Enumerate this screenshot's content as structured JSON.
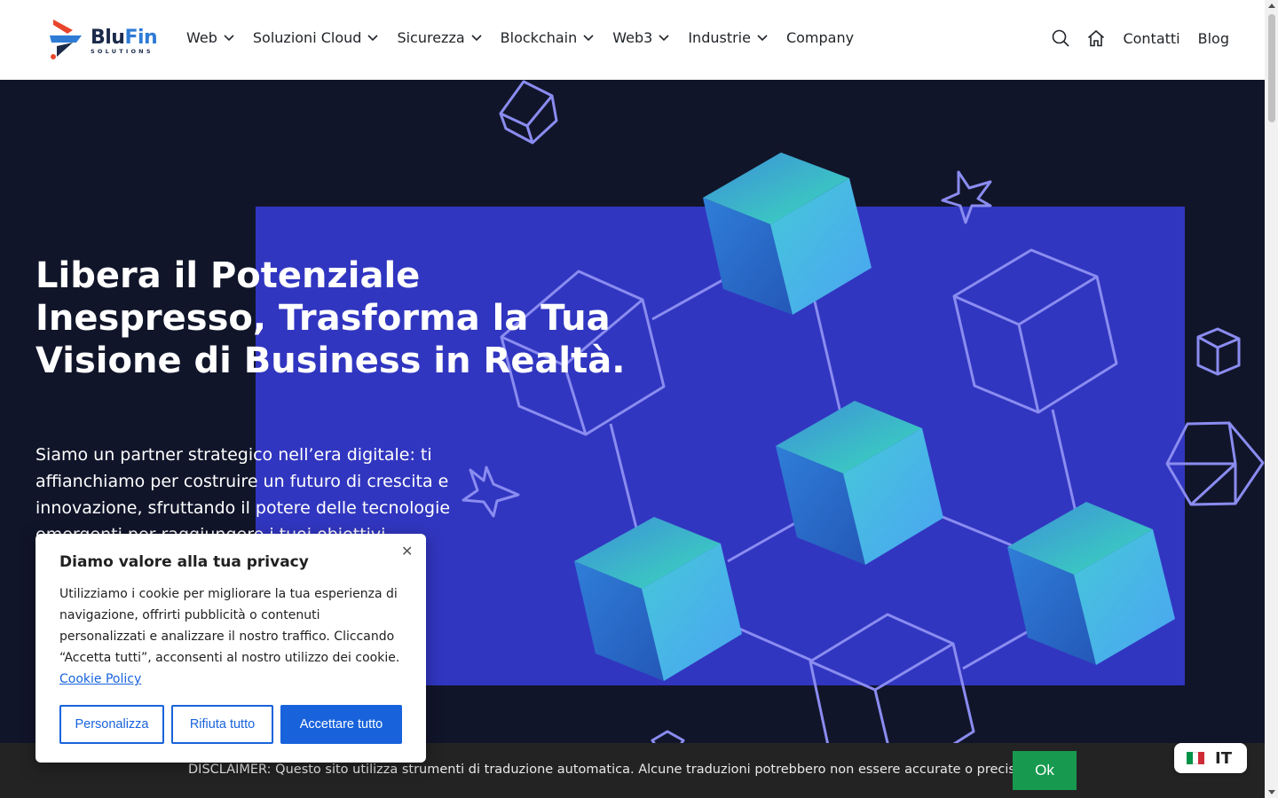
{
  "brand": {
    "name_part1": "Blu",
    "name_part2": "Fin",
    "tagline": "SOLUTIONS",
    "colors": {
      "dark": "#1b2a4a",
      "blue": "#2e7bd6",
      "accent": "#e8462c"
    }
  },
  "nav": {
    "items": [
      {
        "label": "Web",
        "dropdown": true
      },
      {
        "label": "Soluzioni Cloud",
        "dropdown": true
      },
      {
        "label": "Sicurezza",
        "dropdown": true
      },
      {
        "label": "Blockchain",
        "dropdown": true
      },
      {
        "label": "Web3",
        "dropdown": true
      },
      {
        "label": "Industrie",
        "dropdown": true
      },
      {
        "label": "Company",
        "dropdown": false
      }
    ],
    "icons": [
      "search-icon",
      "home-icon"
    ],
    "links": [
      "Contatti",
      "Blog"
    ]
  },
  "hero": {
    "title": "Libera il Potenziale Inespresso, Trasforma la Tua Visione di Business in Realtà.",
    "subtitle": "Siamo un partner strategico nell’era digitale: ti affianchiamo per costruire un futuro di crescita e innovazione, sfruttando il potere delle tecnologie emergenti per raggiungere i tuoi obiettivi.",
    "colors": {
      "background": "#11152a",
      "panel": "#3136c0",
      "outline": "#8a8cf0"
    }
  },
  "cookie_banner": {
    "title": "Diamo valore alla tua privacy",
    "close_icon": "close-icon",
    "body": "Utilizziamo i cookie per migliorare la tua esperienza di navigazione, offrirti pubblicità o contenuti personalizzati e analizzare il nostro traffico. Cliccando “Accetta tutti”, acconsenti al nostro utilizzo dei cookie.",
    "link_label": "Cookie Policy",
    "buttons": {
      "customize": "Personalizza",
      "reject": "Rifiuta tutto",
      "accept": "Accettare tutto"
    },
    "accent": "#1863dc"
  },
  "disclaimer": {
    "text": "DISCLAIMER: Questo sito utilizza strumenti di traduzione automatica. Alcune traduzioni potrebbero non essere accurate o precise.",
    "ok_label": "Ok",
    "ok_color": "#17994f"
  },
  "language": {
    "code": "IT",
    "flag_colors": [
      "#009246",
      "#ffffff",
      "#ce2b37"
    ]
  }
}
